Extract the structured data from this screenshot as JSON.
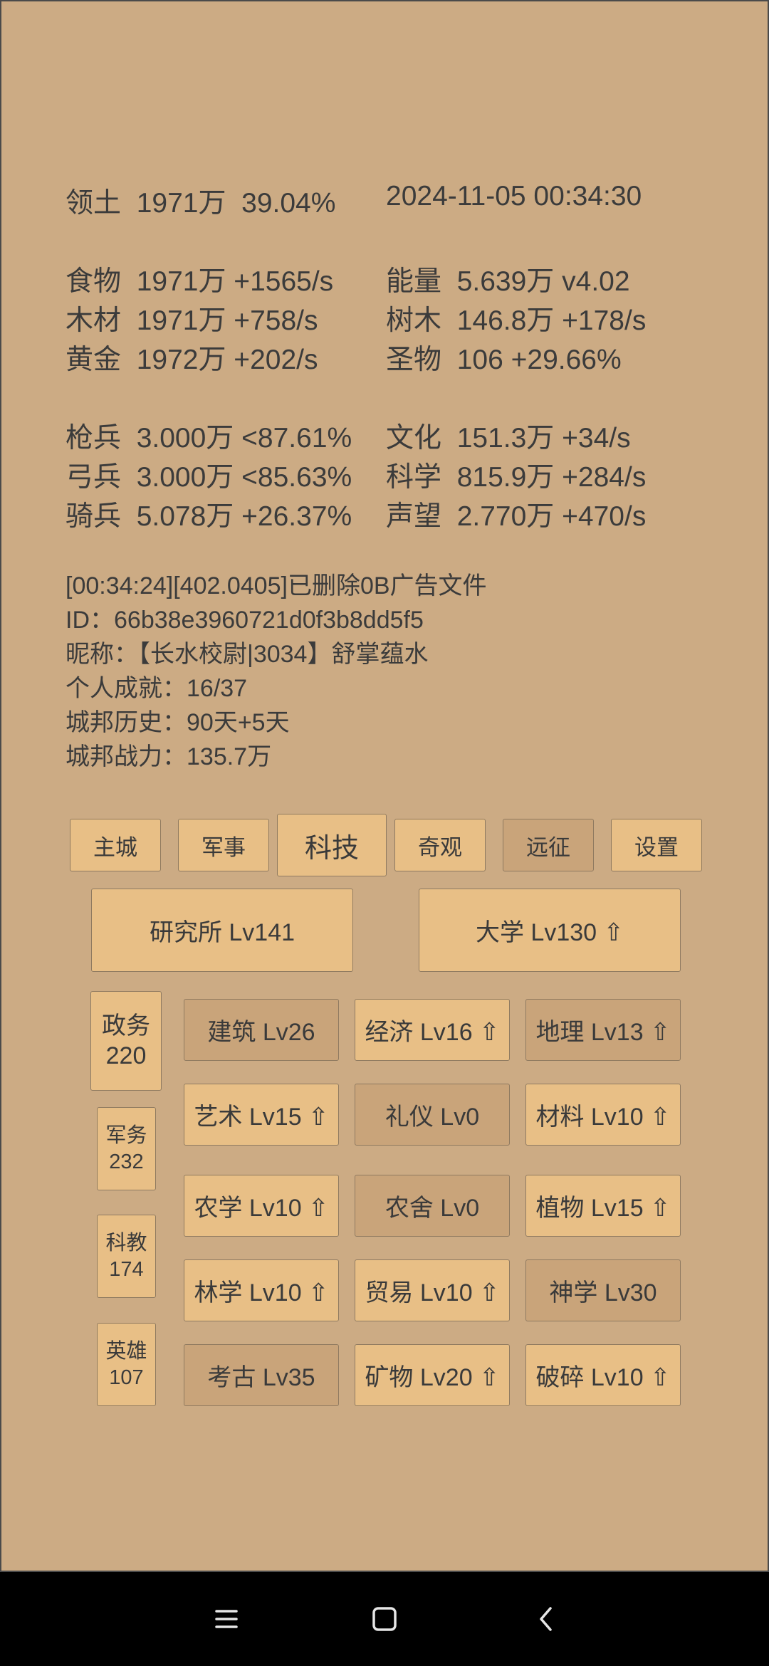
{
  "stats": {
    "territory": {
      "label": "领土",
      "value": "1971万",
      "pct": "39.04%"
    },
    "datetime": "2024-11-05 00:34:30",
    "left": [
      {
        "label": "食物",
        "value": "1971万",
        "rate": "+1565/s"
      },
      {
        "label": "木材",
        "value": "1971万",
        "rate": "+758/s"
      },
      {
        "label": "黄金",
        "value": "1972万",
        "rate": "+202/s"
      },
      {
        "label": "枪兵",
        "value": "3.000万",
        "rate": "<87.61%"
      },
      {
        "label": "弓兵",
        "value": "3.000万",
        "rate": "<85.63%"
      },
      {
        "label": "骑兵",
        "value": "5.078万",
        "rate": "+26.37%"
      }
    ],
    "right": [
      {
        "label": "能量",
        "value": "5.639万",
        "rate": " v4.02"
      },
      {
        "label": "树木",
        "value": "146.8万",
        "rate": "+178/s"
      },
      {
        "label": "圣物",
        "value": "106",
        "rate": "+29.66%"
      },
      {
        "label": "文化",
        "value": "151.3万",
        "rate": "+34/s"
      },
      {
        "label": "科学",
        "value": "815.9万",
        "rate": "+284/s"
      },
      {
        "label": "声望",
        "value": "2.770万",
        "rate": "+470/s"
      }
    ]
  },
  "info": {
    "log": "[00:34:24][402.0405]已删除0B广告文件",
    "id": "ID：66b38e3960721d0f3b8dd5f5",
    "nickname": "昵称：【长水校尉|3034】舒掌蕴水",
    "achievement": "个人成就：16/37",
    "history": "城邦历史：90天+5天",
    "power": "城邦战力：135.7万"
  },
  "tabs": [
    "主城",
    "军事",
    "科技",
    "奇观",
    "远征",
    "设置"
  ],
  "institutions": {
    "research": "研究所 Lv141",
    "university": "大学 Lv130 ⇧"
  },
  "side": [
    {
      "name": "政务",
      "value": "220"
    },
    {
      "name": "军务",
      "value": "232"
    },
    {
      "name": "科教",
      "value": "174"
    },
    {
      "name": "英雄",
      "value": "107"
    }
  ],
  "techs": [
    "建筑 Lv26",
    "经济 Lv16 ⇧",
    "地理 Lv13 ⇧",
    "艺术 Lv15 ⇧",
    "礼仪 Lv0",
    "材料 Lv10 ⇧",
    "农学 Lv10 ⇧",
    "农舍 Lv0",
    "植物 Lv15 ⇧",
    "林学 Lv10 ⇧",
    "贸易 Lv10 ⇧",
    "神学 Lv30",
    "考古 Lv35",
    "矿物 Lv20 ⇧",
    "破碎 Lv10 ⇧"
  ],
  "nav": {
    "menu_icon": "menu-icon",
    "home_icon": "home-icon",
    "back_icon": "back-icon"
  }
}
